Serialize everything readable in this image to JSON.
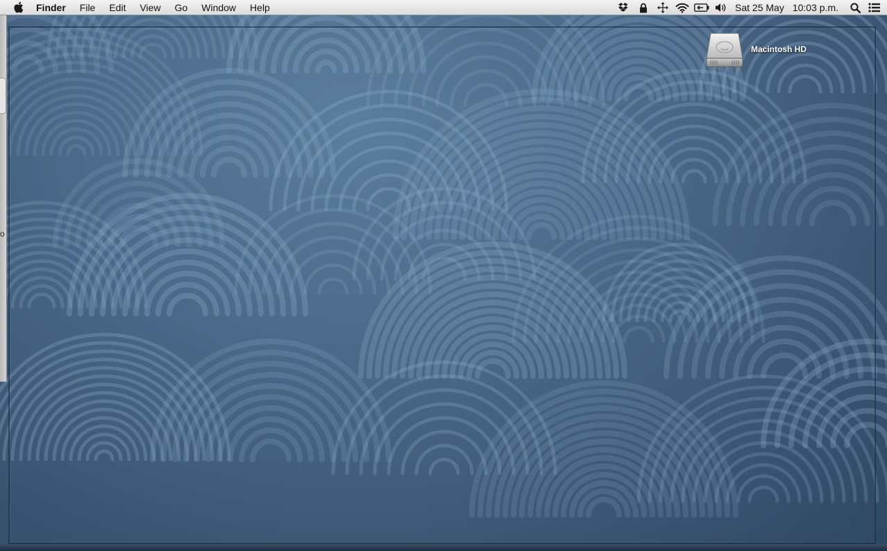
{
  "menubar": {
    "app_name": "Finder",
    "items": [
      "File",
      "Edit",
      "View",
      "Go",
      "Window",
      "Help"
    ],
    "clock": {
      "date": "Sat 25 May",
      "time": "10:03 p.m."
    },
    "tray_icons": [
      "dropbox-icon",
      "lock-icon",
      "move-icon",
      "wifi-icon",
      "battery-icon",
      "volume-icon",
      "spotlight-search-icon",
      "notification-list-icon"
    ]
  },
  "desktop": {
    "drive_label": "Macintosh HD",
    "left_window_glyph": "o"
  },
  "colors": {
    "menubar_bg": "#e8e8e8",
    "wallpaper_base": "#4a6887",
    "pattern_stroke": "#8fb1cc"
  }
}
